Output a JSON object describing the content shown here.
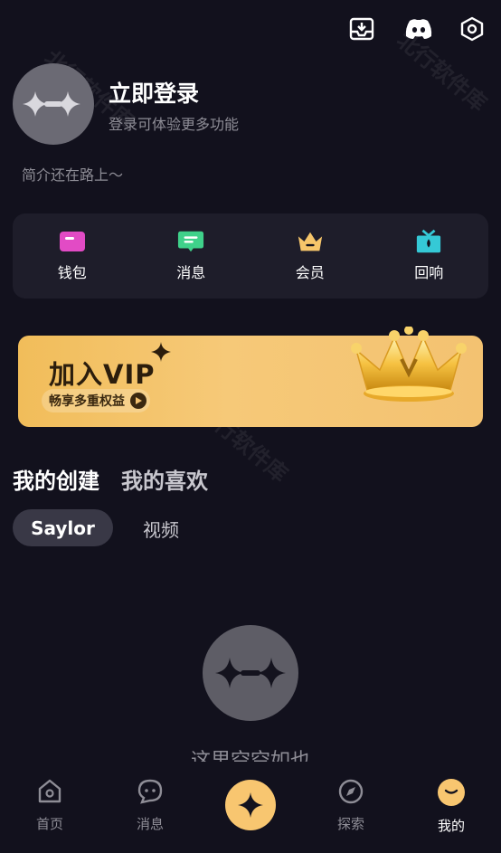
{
  "header": {
    "icons": [
      "inbox-download-icon",
      "discord-icon",
      "settings-hexagon-icon"
    ]
  },
  "profile": {
    "title": "立即登录",
    "subtitle": "登录可体验更多功能",
    "bio": "简介还在路上～"
  },
  "quick_actions": [
    {
      "label": "钱包",
      "icon": "wallet-icon",
      "color": "#e24bc5"
    },
    {
      "label": "消息",
      "icon": "message-icon",
      "color": "#3fd18a"
    },
    {
      "label": "会员",
      "icon": "crown-icon",
      "color": "#f6c56a"
    },
    {
      "label": "回响",
      "icon": "gift-icon",
      "color": "#35c9d6"
    }
  ],
  "vip_banner": {
    "title": "加入VIP",
    "subtitle": "畅享多重权益"
  },
  "section_tabs": {
    "active": "我的创建",
    "inactive": "我的喜欢"
  },
  "filter_chips": {
    "active": "Saylor",
    "inactive": "视频"
  },
  "empty_state": {
    "text": "这里空空如也"
  },
  "bottom_nav": {
    "items": [
      {
        "label": "首页",
        "icon": "home-icon"
      },
      {
        "label": "消息",
        "icon": "chat-bubble-icon"
      },
      {
        "label": "探索",
        "icon": "compass-icon"
      },
      {
        "label": "我的",
        "icon": "profile-face-icon"
      }
    ],
    "center_icon": "sparkle-create-icon",
    "active_index": 3
  },
  "watermark": "北行软件库",
  "colors": {
    "background": "#12111d",
    "card": "#1e1d2a",
    "accent": "#f8c670"
  }
}
